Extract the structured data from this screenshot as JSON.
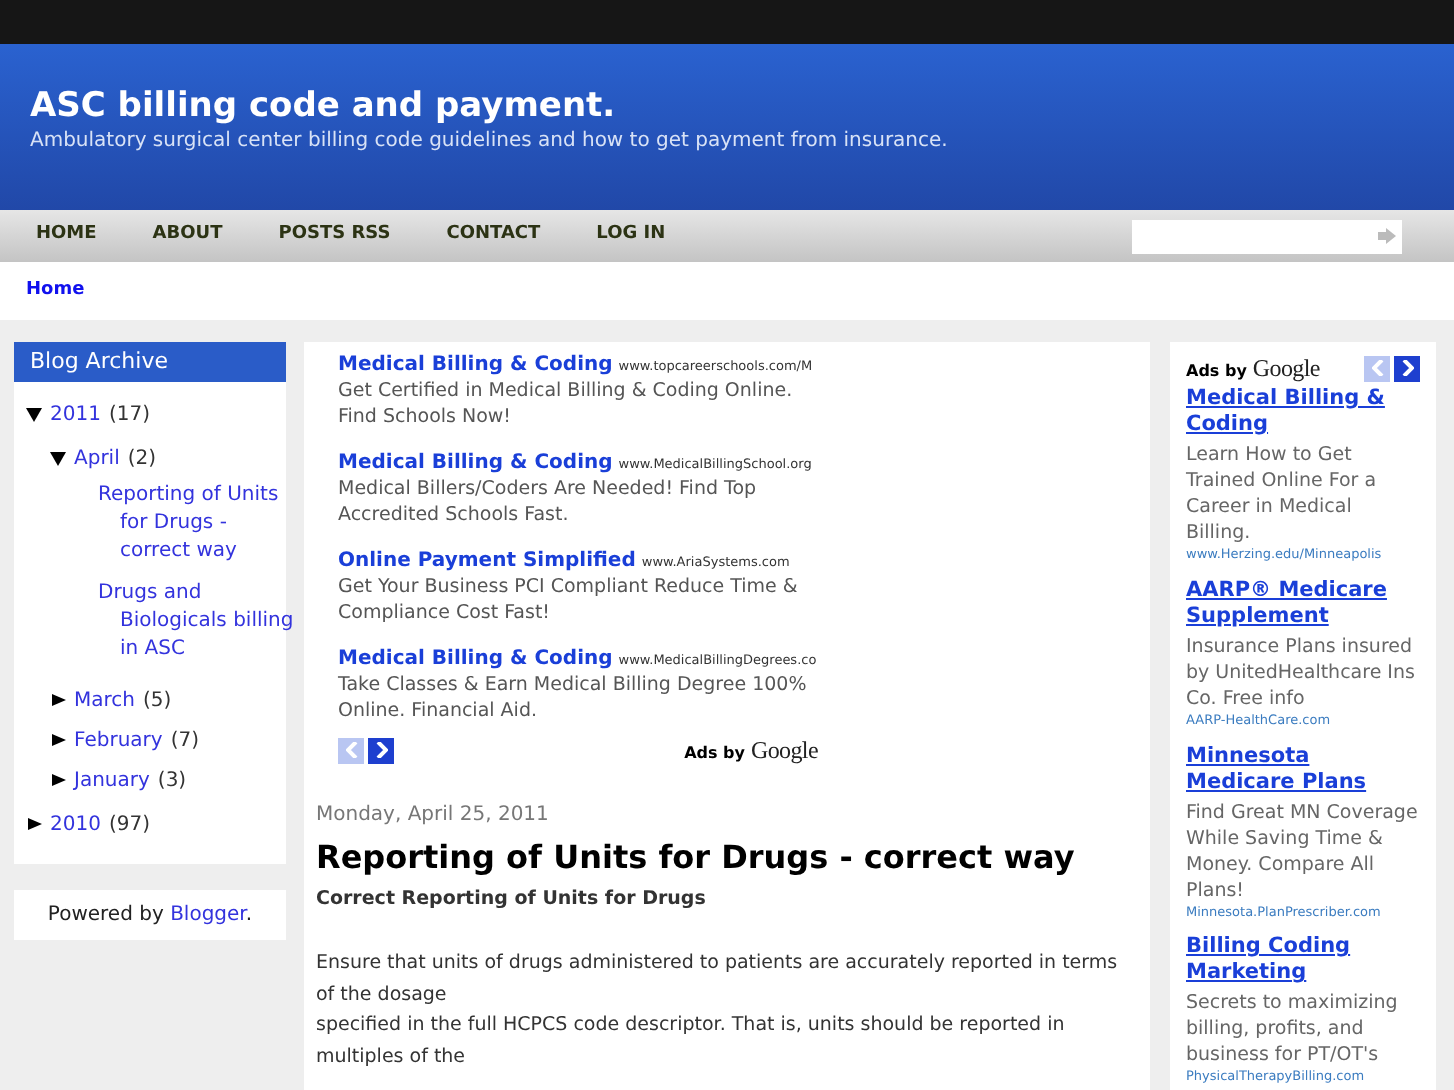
{
  "header": {
    "title": "ASC billing code and payment.",
    "description": "Ambulatory surgical center billing code guidelines and how to get payment from insurance."
  },
  "nav": {
    "items": [
      {
        "label": "HOME"
      },
      {
        "label": "ABOUT"
      },
      {
        "label": "POSTS RSS"
      },
      {
        "label": "CONTACT"
      },
      {
        "label": "LOG IN"
      }
    ]
  },
  "breadcrumb": "Home",
  "sidebar": {
    "archive": {
      "title": "Blog Archive",
      "items": [
        {
          "label": "2011",
          "count": "(17)",
          "expanded": true,
          "children": [
            {
              "label": "April",
              "count": "(2)",
              "expanded": true,
              "children": [
                {
                  "label": "Reporting of Units for Drugs - correct way"
                },
                {
                  "label": "Drugs and Biologicals billing in ASC"
                }
              ]
            },
            {
              "label": "March",
              "count": "(5)",
              "expanded": false
            },
            {
              "label": "February",
              "count": "(7)",
              "expanded": false
            },
            {
              "label": "January",
              "count": "(3)",
              "expanded": false
            }
          ]
        },
        {
          "label": "2010",
          "count": "(97)",
          "expanded": false
        }
      ]
    },
    "powered_by": {
      "text": "Powered by ",
      "link": "Blogger",
      "suffix": "."
    }
  },
  "top_ads": {
    "ads": [
      {
        "title": "Medical Billing & Coding",
        "url": "www.topcareerschools.com/M",
        "text": "Get Certified in Medical Billing & Coding Online. Find Schools Now!"
      },
      {
        "title": "Medical Billing & Coding",
        "url": "www.MedicalBillingSchool.org",
        "text": "Medical Billers/Coders Are Needed! Find Top Accredited Schools Fast."
      },
      {
        "title": "Online Payment Simplified",
        "url": "www.AriaSystems.com",
        "text": "Get Your Business PCI Compliant Reduce Time & Compliance Cost Fast!"
      },
      {
        "title": "Medical Billing & Coding",
        "url": "www.MedicalBillingDegrees.co",
        "text": "Take Classes & Earn Medical Billing Degree 100% Online. Financial Aid."
      }
    ],
    "pager": {
      "previous_disabled": true,
      "next_disabled": false
    },
    "ads_by": "Ads by",
    "brand": "Google"
  },
  "post": {
    "date": "Monday, April 25, 2011",
    "title": "Reporting of Units for Drugs - correct way",
    "subtitle": "Correct Reporting of Units for Drugs",
    "lines": [
      "Ensure that units of drugs administered to patients are accurately reported in terms of the dosage",
      "specified in the full HCPCS code descriptor. That is, units should be reported in multiples of the"
    ]
  },
  "side_ads": {
    "ads_by": "Ads by",
    "brand": "Google",
    "pager": {
      "previous_disabled": true,
      "next_disabled": false
    },
    "ads": [
      {
        "title": "Medical Billing & Coding",
        "text": "Learn How to Get Trained Online For a Career in Medical Billing.",
        "url": "www.Herzing.edu/Minneapolis"
      },
      {
        "title": "AARP® Medicare Supplement",
        "text": "Insurance Plans insured by UnitedHealthcare Ins Co. Free info",
        "url": "AARP-HealthCare.com"
      },
      {
        "title": "Minnesota Medicare Plans",
        "text": "Find Great MN Coverage While Saving Time & Money. Compare All Plans!",
        "url": "Minnesota.PlanPrescriber.com"
      },
      {
        "title": "Billing Coding Marketing",
        "text": "Secrets to maximizing billing, profits, and business for PT/OT's",
        "url": "PhysicalTherapyBilling.com"
      }
    ]
  }
}
